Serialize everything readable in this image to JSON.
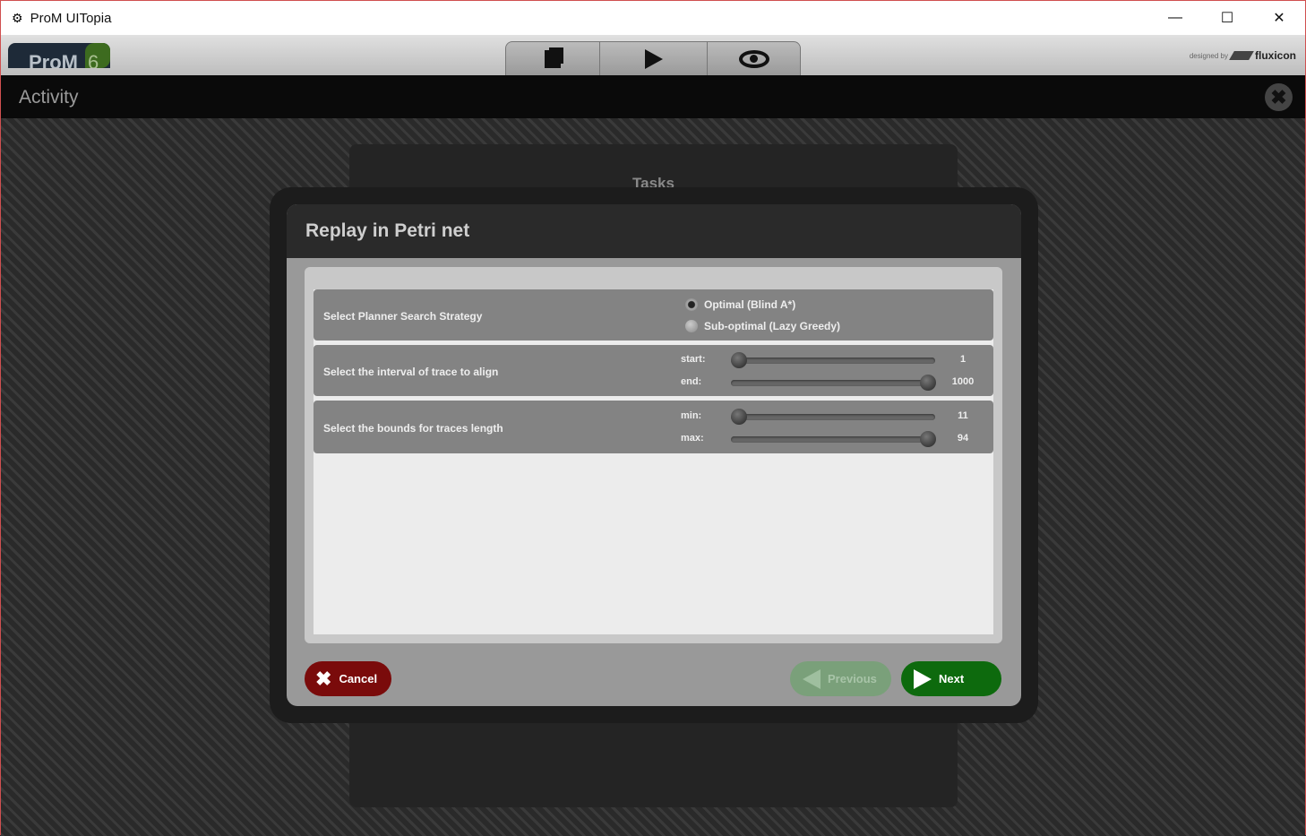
{
  "window": {
    "title": "ProM UITopia",
    "minimize": "—",
    "maximize": "☐",
    "close": "✕"
  },
  "header": {
    "logo_text": "ProM",
    "logo_version": "6",
    "tabs": [
      {
        "icon": "workspace-icon"
      },
      {
        "icon": "play-icon"
      },
      {
        "icon": "eye-icon"
      }
    ],
    "designed_by": "designed by",
    "brand": "fluxicon"
  },
  "activity": {
    "title": "Activity"
  },
  "tasks": {
    "title": "Tasks"
  },
  "dialog": {
    "title": "Replay in Petri net",
    "strategy": {
      "label": "Select Planner Search Strategy",
      "options": [
        "Optimal (Blind A*)",
        "Sub-optimal (Lazy Greedy)"
      ],
      "selected": 0
    },
    "interval": {
      "label": "Select the interval of trace to align",
      "start_label": "start:",
      "start_value": "1",
      "start_fraction": 0,
      "end_label": "end:",
      "end_value": "1000",
      "end_fraction": 1
    },
    "bounds": {
      "label": "Select the bounds for traces length",
      "min_label": "min:",
      "min_value": "11",
      "min_fraction": 0,
      "max_label": "max:",
      "max_value": "94",
      "max_fraction": 1
    },
    "cancel": "Cancel",
    "previous": "Previous",
    "next": "Next"
  },
  "colors": {
    "cancel": "#7a0b0b",
    "next": "#0d6a0d",
    "previous_disabled": "#7aa07a"
  }
}
